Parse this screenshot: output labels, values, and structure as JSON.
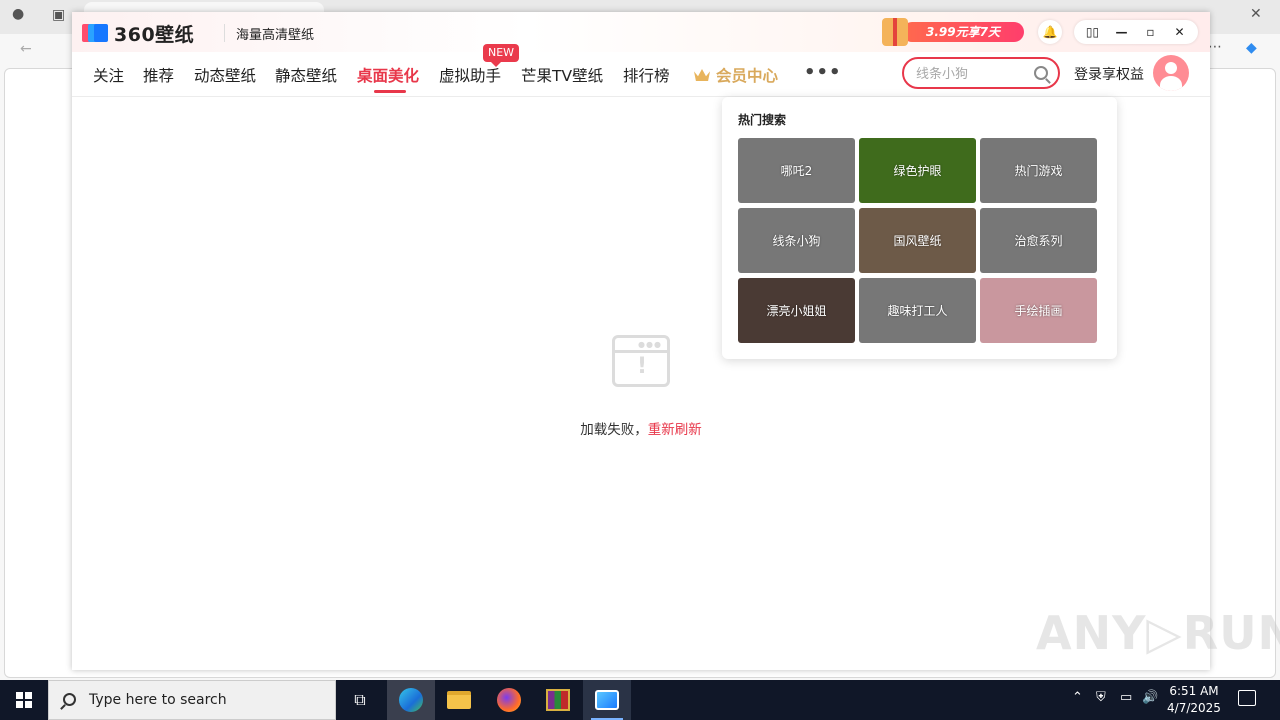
{
  "app": {
    "logo_text": "360壁纸",
    "tagline": "海量高清壁纸",
    "promo_text": "3.99元享7天",
    "window_controls": {
      "bell_icon": "bell-icon",
      "mini": "▯▯",
      "minimize": "—",
      "maximize": "▫",
      "close": "✕"
    }
  },
  "nav": {
    "items": [
      {
        "label": "关注"
      },
      {
        "label": "推荐"
      },
      {
        "label": "动态壁纸"
      },
      {
        "label": "静态壁纸"
      },
      {
        "label": "桌面美化",
        "active": true
      },
      {
        "label": "虚拟助手",
        "badge": "NEW"
      },
      {
        "label": "芒果TV壁纸"
      },
      {
        "label": "排行榜"
      }
    ],
    "vip_label": "会员中心",
    "more_label": "•••",
    "search_placeholder": "线条小狗",
    "login_label": "登录享权益"
  },
  "error": {
    "message": "加载失败，",
    "retry": "重新刷新"
  },
  "hot_search": {
    "title": "热门搜索",
    "items": [
      {
        "label": "哪吒2",
        "color": "#777777"
      },
      {
        "label": "绿色护眼",
        "color": "#3f6b1c"
      },
      {
        "label": "热门游戏",
        "color": "#777777"
      },
      {
        "label": "线条小狗",
        "color": "#777777"
      },
      {
        "label": "国风壁纸",
        "color": "#6d5a48"
      },
      {
        "label": "治愈系列",
        "color": "#777777"
      },
      {
        "label": "漂亮小姐姐",
        "color": "#4a3a34"
      },
      {
        "label": "趣味打工人",
        "color": "#777777"
      },
      {
        "label": "手绘插画",
        "color": "#c9979e"
      }
    ]
  },
  "watermark": "ANY▷RUN",
  "taskbar": {
    "search_text": "Type here to search",
    "time": "6:51 AM",
    "date": "4/7/2025"
  }
}
